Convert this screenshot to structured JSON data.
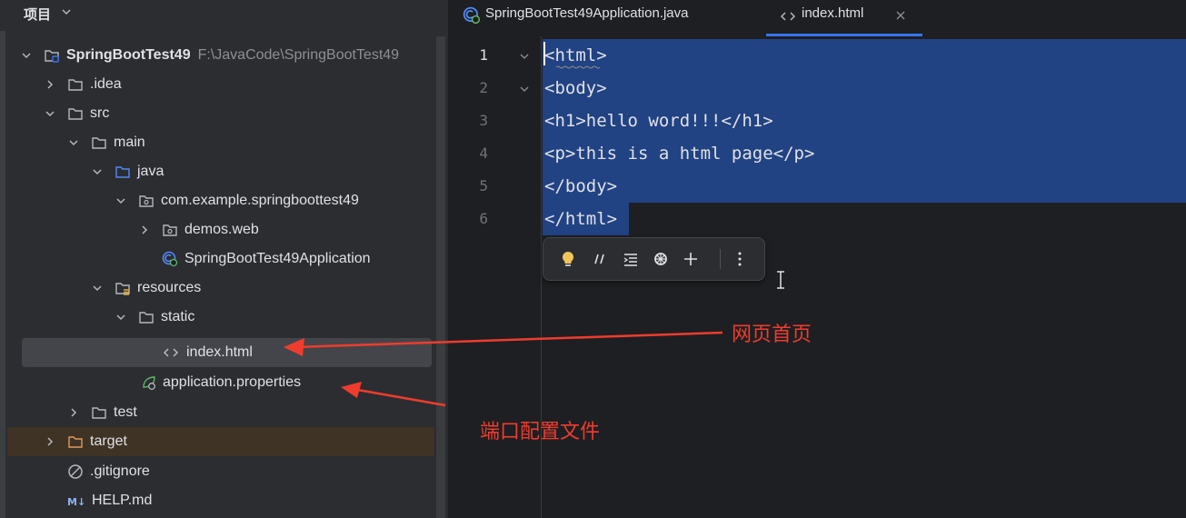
{
  "project_panel": {
    "title": "项目",
    "tree": [
      {
        "label": "SpringBootTest49",
        "path": "F:\\JavaCode\\SpringBootTest49"
      },
      {
        "label": ".idea"
      },
      {
        "label": "src"
      },
      {
        "label": "main"
      },
      {
        "label": "java"
      },
      {
        "label": "com.example.springboottest49"
      },
      {
        "label": "demos.web"
      },
      {
        "label": "SpringBootTest49Application"
      },
      {
        "label": "resources"
      },
      {
        "label": "static"
      },
      {
        "label": "index.html"
      },
      {
        "label": "application.properties"
      },
      {
        "label": "test"
      },
      {
        "label": "target"
      },
      {
        "label": ".gitignore"
      },
      {
        "label": "HELP.md"
      }
    ]
  },
  "editor": {
    "tabs": [
      {
        "label": "SpringBootTest49Application.java"
      },
      {
        "label": "index.html"
      }
    ],
    "line_numbers": [
      "1",
      "2",
      "3",
      "4",
      "5",
      "6"
    ],
    "code_lines": [
      "<html>",
      "<body>",
      "<h1>hello word!!!</h1>",
      "<p>this is a html page</p>",
      "</body>",
      "</html>"
    ],
    "toolbar_icons": [
      "bulb-icon",
      "comment-icon",
      "format-icon",
      "ai-assistant-icon",
      "add-icon",
      "more-icon"
    ]
  },
  "annotations": {
    "homepage_label": "网页首页",
    "port_config_label": "端口配置文件",
    "color": "#f03c2e"
  },
  "colors": {
    "selection": "#214283",
    "accent": "#3574f0",
    "annotation": "#f03c2e"
  }
}
